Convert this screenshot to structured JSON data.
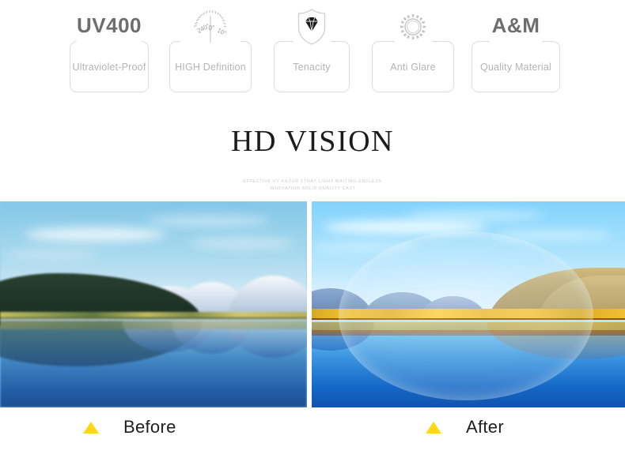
{
  "features": [
    {
      "id": "uv400",
      "headline": "UV400",
      "caption": "Ultraviolet-Proof",
      "icon": "none",
      "icon_name": "uv400-text-badge"
    },
    {
      "id": "high-definition",
      "headline": "",
      "caption": "HIGH Definition",
      "icon": "gauge",
      "icon_name": "gauge-dial-icon",
      "gauge_labels": [
        "240°",
        "0°",
        "10°"
      ]
    },
    {
      "id": "tenacity",
      "headline": "",
      "caption": "Tenacity",
      "icon": "shield-diamond",
      "icon_name": "shield-diamond-icon"
    },
    {
      "id": "anti-glare",
      "headline": "",
      "caption": "Anti Glare",
      "icon": "sun",
      "icon_name": "sun-rays-icon"
    },
    {
      "id": "quality-material",
      "headline": "A&M",
      "caption": "Quality Material",
      "icon": "none",
      "icon_name": "am-text-badge"
    }
  ],
  "title": {
    "main": "HD VISION",
    "sub_line_1": "EFFECTIVE UV FILTER STRAY LIGHT  WAITING ENDLESS",
    "sub_line_2": "INNOVATION SOLID QUALITY CAST"
  },
  "comparison": {
    "before_label": "Before",
    "after_label": "After",
    "marker_color": "#ffd814",
    "before_alt": "blurred cool-toned lake and mountain landscape with reflection",
    "after_alt": "sharp warm-toned autumn lake and mountain landscape viewed through lens"
  },
  "colors": {
    "box_border": "#dcdcdc",
    "caption_text": "#b4b4b4",
    "headline_text": "#6e6e6e",
    "title_text": "#1c1c1c",
    "subtitle_text": "#c9c9c9",
    "label_text": "#1f1f1f",
    "accent_yellow": "#ffd814",
    "background": "#ffffff"
  }
}
